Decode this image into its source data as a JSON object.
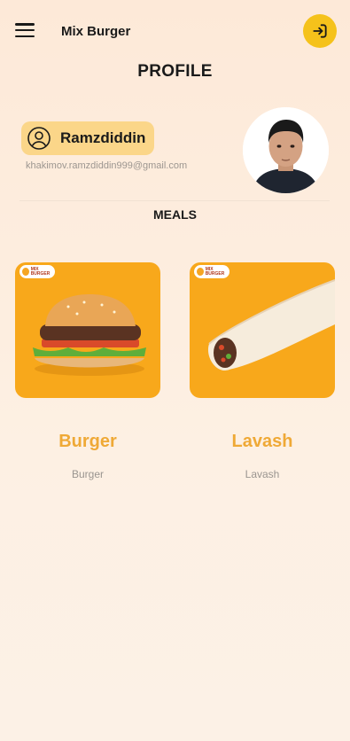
{
  "header": {
    "title": "Mix Burger",
    "menu_icon": "hamburger-menu-icon",
    "logout_icon": "logout-icon"
  },
  "page": {
    "title": "PROFILE"
  },
  "profile": {
    "name": "Ramzdiddin",
    "email": "khakimov.ramzdiddin999@gmail.com",
    "user_icon": "user-circle-icon"
  },
  "meals": {
    "section_title": "MEALS",
    "items": [
      {
        "name": "Burger",
        "subtitle": "Burger",
        "brand_badge": "MIX BURGER"
      },
      {
        "name": "Lavash",
        "subtitle": "Lavash",
        "brand_badge": "MIX BURGER"
      }
    ]
  },
  "colors": {
    "accent": "#f5c21b",
    "meal_name": "#efa936",
    "card_bg": "#f8a81b",
    "chip_bg": "#fbd689"
  }
}
